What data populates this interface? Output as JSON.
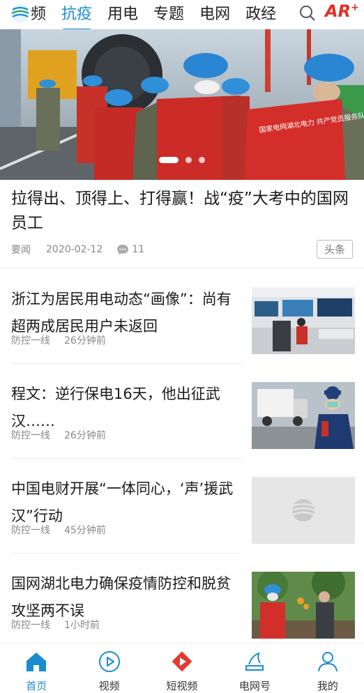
{
  "top_nav": {
    "tabs": [
      {
        "label": "频"
      },
      {
        "label": "抗疫",
        "active": true
      },
      {
        "label": "用电"
      },
      {
        "label": "专题"
      },
      {
        "label": "电网"
      },
      {
        "label": "政经"
      }
    ],
    "ar_label": "AR",
    "ar_plus": "+",
    "accent_color": "#1a8ccf"
  },
  "hero": {
    "vest_text": "国家电网湖北电力 共产党员服务队",
    "headline": "拉得出、顶得上、打得赢！战“疫”大考中的国网员工",
    "category": "要闻",
    "date": "2020-02-12",
    "comments": "11",
    "badge": "头条",
    "carousel_count": 3,
    "carousel_active": 1
  },
  "news": [
    {
      "title": "浙江为居民用电动态“画像”：尚有超两成居民用户未返回",
      "source": "防控一线",
      "time": "26分钟前",
      "thumb": "control-room"
    },
    {
      "title": "程文：逆行保电16天，他出征武汉……",
      "source": "防控一线",
      "time": "26分钟前",
      "thumb": "worker-truck"
    },
    {
      "title": "中国电财开展“一体同心，‘声’援武汉”行动",
      "source": "防控一线",
      "time": "45分钟前",
      "thumb": "placeholder"
    },
    {
      "title": "国网湖北电力确保疫情防控和脱贫攻坚两不误",
      "source": "防控一线",
      "time": "1小时前",
      "thumb": "farm"
    }
  ],
  "tab_bar": [
    {
      "label": "首页",
      "icon": "home-icon",
      "active": true
    },
    {
      "label": "视频",
      "icon": "video-play-icon"
    },
    {
      "label": "短视频",
      "icon": "short-video-icon"
    },
    {
      "label": "电网号",
      "icon": "grid-account-icon"
    },
    {
      "label": "我的",
      "icon": "user-icon"
    }
  ]
}
